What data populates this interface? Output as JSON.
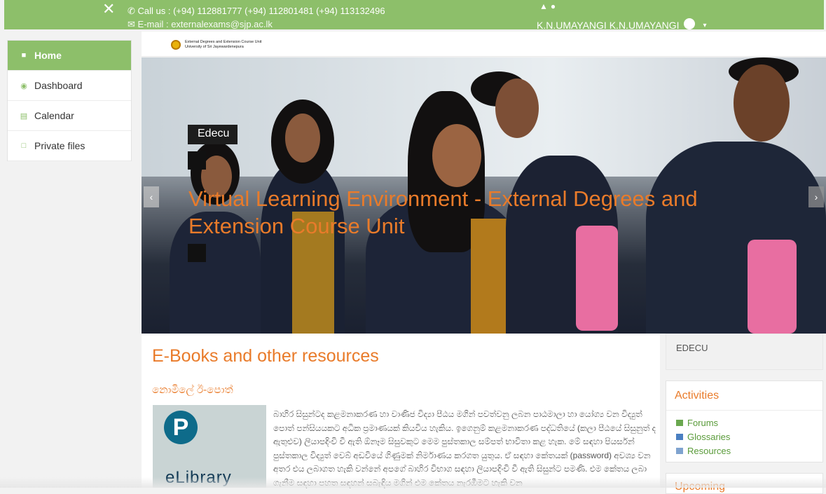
{
  "topbar": {
    "call_text": "Call us : (+94) 112881777 (+94) 112801481 (+94) 113132496",
    "email_text": "E-mail : externalexams@sjp.ac.lk",
    "user_name": "K.N.UMAYANGI K.N.UMAYANGI",
    "close_glyph": "✕",
    "caret_glyph": "▾"
  },
  "sidebar": {
    "items": [
      {
        "label": "Home",
        "icon": "home-icon",
        "active": true
      },
      {
        "label": "Dashboard",
        "icon": "dashboard-icon",
        "active": false
      },
      {
        "label": "Calendar",
        "icon": "calendar-icon",
        "active": false
      },
      {
        "label": "Private files",
        "icon": "file-icon",
        "active": false
      }
    ]
  },
  "logo": {
    "line1": "External Degrees and Extension Course Unit",
    "line2": "University of Sri Jayewardenepura"
  },
  "hero": {
    "tag": "Edecu",
    "title": "Virtual Learning Environment - External Degrees and Extension Course Unit",
    "prev_glyph": "‹",
    "next_glyph": "›"
  },
  "main": {
    "heading": "E-Books and other resources",
    "subheading": "නොමිලේ ඊ-පොත්",
    "elibrary_label": "eLibrary",
    "pearson_glyph": "P",
    "paragraph": "බාහිර සිසුන්ටද කළමනාකරණ හා වාණිජ විද්‍යා පීඨය මගින් පවත්වනු ලබන පාඨමාලා හා යෝග්‍ය වන විද්‍යුත් පොත් පන්සියයකට අධික ප්‍රමාණයක් කියවිය හැකිය. ඉගෙනුම් කළමනාකරණ පද්ධතියේ (කලා පීඨයේ සිසුනුත් ද ඇතුළුව) ලියාපදිංචි වී ඇති ඕනෑම සිසුවකුට මෙම පුස්තකාල සම්පත් භාවිතා කළ හැක. මේ සඳහා පියර්සන් පුස්තකාල විද්‍යුත් වෙබ් අඩවියේ ගිණුමක් නිර්මාණය කරගත යුතුය. ඒ සඳහා කේතයක් (password) අවශ්‍ය වන අතර එය ලබාගත හැකි වන්නේ අපගේ බාහිර විභාග සඳහා ලියාපදිංචි වී ඇති සිසුන්ට පමණි. එම කේතය ලබා ගැනීම සඳහා පහත සඳහන් සබැඳිය මගින් එම කේතය නැරඹීමට හැකි වන"
  },
  "right": {
    "edecu": "EDECU",
    "activities_title": "Activities",
    "activities": [
      {
        "label": "Forums",
        "icon": "forum-icon",
        "color": "#6aa84f"
      },
      {
        "label": "Glossaries",
        "icon": "glossary-icon",
        "color": "#4a7fc1"
      },
      {
        "label": "Resources",
        "icon": "resource-icon",
        "color": "#7fa3cf"
      }
    ],
    "upcoming_title": "Upcoming"
  },
  "colors": {
    "accent_green": "#8dbf6a",
    "accent_orange": "#e97b2a"
  }
}
